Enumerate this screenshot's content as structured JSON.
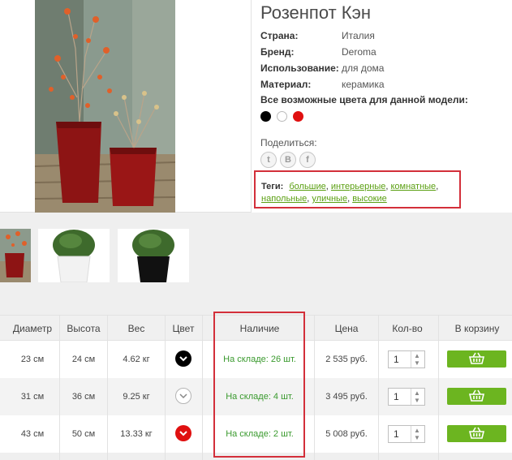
{
  "product": {
    "title": "Розенпот Кэн",
    "properties": [
      {
        "label": "Страна:",
        "value": "Италия"
      },
      {
        "label": "Бренд:",
        "value": "Deroma"
      },
      {
        "label": "Использование:",
        "value": "для дома"
      },
      {
        "label": "Материал:",
        "value": "керамика"
      }
    ],
    "colors_title": "Все возможные цвета для данной модели:",
    "colors": [
      "#000000",
      "#ffffff",
      "#e01010"
    ],
    "share_label": "Поделиться:",
    "share_icons": [
      "twitter-icon",
      "vk-icon",
      "facebook-icon"
    ],
    "share_glyphs": [
      "t",
      "B",
      "f"
    ],
    "tags_label": "Теги:",
    "tags": [
      "большие",
      "интерьерные",
      "комнатные",
      "напольные",
      "уличные",
      "высокие"
    ]
  },
  "table": {
    "headers": [
      "Диаметр",
      "Высота",
      "Вес",
      "Цвет",
      "Наличие",
      "Цена",
      "Кол-во",
      "В корзину"
    ],
    "rows": [
      {
        "diameter": "23 см",
        "height": "24 см",
        "weight": "4.62 кг",
        "color": "black",
        "stock": "На складе: 26 шт.",
        "price": "2 535 руб.",
        "qty": "1"
      },
      {
        "diameter": "31 см",
        "height": "36 см",
        "weight": "9.25 кг",
        "color": "white",
        "stock": "На складе: 4 шт.",
        "price": "3 495 руб.",
        "qty": "1"
      },
      {
        "diameter": "43 см",
        "height": "50 см",
        "weight": "13.33 кг",
        "color": "red",
        "stock": "На складе: 2 шт.",
        "price": "5 008 руб.",
        "qty": "1"
      }
    ]
  },
  "accent_colors": {
    "link": "#5a9f11",
    "stock": "#3a9a2e",
    "cart": "#6cb520",
    "highlight": "#d32f3a"
  }
}
